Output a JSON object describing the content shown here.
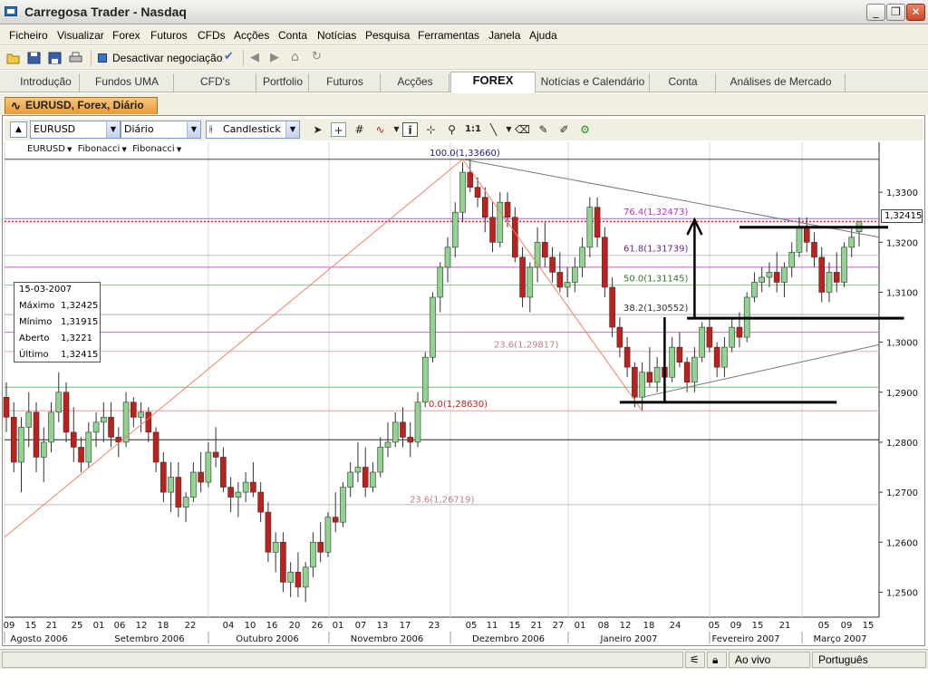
{
  "window": {
    "title": "Carregosa Trader - Nasdaq"
  },
  "menu": [
    "Ficheiro",
    "Visualizar",
    "Forex",
    "Futuros",
    "CFDs",
    "Acções",
    "Conta",
    "Notícias",
    "Pesquisa",
    "Ferramentas",
    "Janela",
    "Ajuda"
  ],
  "toolbar": {
    "deactivate_label": "Desactivar negociação"
  },
  "tabs": [
    "Introdução",
    "Fundos UMA",
    "CFD's",
    "Portfolio",
    "Futuros",
    "Acções",
    "FOREX",
    "Notícias e Calendário",
    "Conta",
    "Análises de Mercado"
  ],
  "active_tab": "FOREX",
  "document_tab": {
    "label": "EURUSD, Forex, Diário"
  },
  "chart_controls": {
    "symbol": "EURUSD",
    "period": "Diário",
    "chart_style": "Candlestick"
  },
  "chart_legend": {
    "symbol": "EURUSD",
    "study1": "Fibonacci",
    "study2": "Fibonacci"
  },
  "info_box": {
    "date": "15-03-2007",
    "max_label": "Máximo",
    "max_value": "1,32425",
    "min_label": "Mínimo",
    "min_value": "1,31915",
    "open_label": "Aberto",
    "open_value": "1,3221",
    "last_label": "Último",
    "last_value": "1,32415"
  },
  "price_marker": "1,32415",
  "status": {
    "live": "Ao vivo",
    "language": "Português"
  },
  "colors": {
    "bull": "#8fd48f",
    "bear": "#c0201c",
    "fib": "#d23ed2",
    "dotted": "#e02020"
  },
  "chart_data": {
    "type": "candlestick",
    "yaxis": {
      "min": 1.245,
      "max": 1.34,
      "ticks": [
        "1,2500",
        "1,2600",
        "1,2700",
        "1,2800",
        "1,2900",
        "1,3000",
        "1,3100",
        "1,3200",
        "1,3300"
      ]
    },
    "xticks": [
      "09",
      "15",
      "21",
      "25",
      "01",
      "06",
      "12",
      "18",
      "22",
      "04",
      "10",
      "16",
      "20",
      "26",
      "01",
      "07",
      "13",
      "17",
      "23",
      "05",
      "11",
      "15",
      "21",
      "27",
      "01",
      "08",
      "12",
      "18",
      "24",
      "05",
      "09",
      "15",
      "21",
      "05",
      "09",
      "15"
    ],
    "months": [
      "Agosto 2006",
      "Setembro 2006",
      "Outubro 2006",
      "Novembro 2006",
      "Dezembro 2006",
      "Janeiro 2007",
      "Fevereiro 2007",
      "Março 2007"
    ],
    "fib_labels": [
      {
        "text": "100.0(1,33660)",
        "y": 1.3366
      },
      {
        "text": "76.4(1,32473)",
        "y": 1.32473
      },
      {
        "text": "61.8(1,31739)",
        "y": 1.31739
      },
      {
        "text": "50.0(1,31145)",
        "y": 1.31145
      },
      {
        "text": "38.2(1,30552)",
        "y": 1.30552
      },
      {
        "text": "23.6(1,29817)",
        "y": 1.29817
      },
      {
        "text": "0.0(1,28630)",
        "y": 1.2863
      },
      {
        "text": "23.6(1,26719)",
        "y": 1.26719
      }
    ],
    "candles": [
      [
        1.289,
        1.292,
        1.282,
        1.285
      ],
      [
        1.285,
        1.288,
        1.274,
        1.276
      ],
      [
        1.276,
        1.285,
        1.27,
        1.283
      ],
      [
        1.283,
        1.29,
        1.279,
        1.286
      ],
      [
        1.286,
        1.288,
        1.274,
        1.277
      ],
      [
        1.277,
        1.283,
        1.272,
        1.28
      ],
      [
        1.28,
        1.288,
        1.278,
        1.286
      ],
      [
        1.286,
        1.294,
        1.284,
        1.29
      ],
      [
        1.29,
        1.292,
        1.28,
        1.282
      ],
      [
        1.282,
        1.287,
        1.276,
        1.279
      ],
      [
        1.279,
        1.281,
        1.274,
        1.276
      ],
      [
        1.276,
        1.284,
        1.275,
        1.282
      ],
      [
        1.282,
        1.286,
        1.279,
        1.284
      ],
      [
        1.284,
        1.288,
        1.28,
        1.285
      ],
      [
        1.285,
        1.288,
        1.279,
        1.281
      ],
      [
        1.281,
        1.283,
        1.277,
        1.28
      ],
      [
        1.28,
        1.29,
        1.279,
        1.288
      ],
      [
        1.288,
        1.289,
        1.283,
        1.285
      ],
      [
        1.285,
        1.288,
        1.282,
        1.286
      ],
      [
        1.286,
        1.287,
        1.28,
        1.282
      ],
      [
        1.282,
        1.283,
        1.274,
        1.276
      ],
      [
        1.276,
        1.278,
        1.268,
        1.27
      ],
      [
        1.27,
        1.276,
        1.266,
        1.273
      ],
      [
        1.273,
        1.276,
        1.265,
        1.267
      ],
      [
        1.267,
        1.27,
        1.264,
        1.269
      ],
      [
        1.269,
        1.276,
        1.268,
        1.274
      ],
      [
        1.274,
        1.278,
        1.27,
        1.272
      ],
      [
        1.272,
        1.28,
        1.271,
        1.278
      ],
      [
        1.278,
        1.283,
        1.275,
        1.277
      ],
      [
        1.277,
        1.279,
        1.27,
        1.271
      ],
      [
        1.271,
        1.273,
        1.266,
        1.269
      ],
      [
        1.269,
        1.272,
        1.265,
        1.27
      ],
      [
        1.27,
        1.274,
        1.268,
        1.272
      ],
      [
        1.272,
        1.276,
        1.269,
        1.27
      ],
      [
        1.27,
        1.272,
        1.264,
        1.266
      ],
      [
        1.266,
        1.268,
        1.256,
        1.258
      ],
      [
        1.258,
        1.262,
        1.254,
        1.26
      ],
      [
        1.26,
        1.262,
        1.25,
        1.252
      ],
      [
        1.252,
        1.256,
        1.249,
        1.254
      ],
      [
        1.254,
        1.258,
        1.249,
        1.251
      ],
      [
        1.251,
        1.256,
        1.248,
        1.255
      ],
      [
        1.255,
        1.262,
        1.253,
        1.26
      ],
      [
        1.26,
        1.264,
        1.256,
        1.258
      ],
      [
        1.258,
        1.266,
        1.257,
        1.265
      ],
      [
        1.265,
        1.27,
        1.262,
        1.264
      ],
      [
        1.264,
        1.272,
        1.263,
        1.271
      ],
      [
        1.271,
        1.276,
        1.269,
        1.274
      ],
      [
        1.274,
        1.28,
        1.272,
        1.275
      ],
      [
        1.275,
        1.279,
        1.269,
        1.271
      ],
      [
        1.271,
        1.276,
        1.27,
        1.274
      ],
      [
        1.274,
        1.281,
        1.273,
        1.279
      ],
      [
        1.279,
        1.284,
        1.277,
        1.28
      ],
      [
        1.28,
        1.286,
        1.279,
        1.284
      ],
      [
        1.284,
        1.287,
        1.279,
        1.281
      ],
      [
        1.281,
        1.284,
        1.277,
        1.28
      ],
      [
        1.28,
        1.29,
        1.279,
        1.288
      ],
      [
        1.288,
        1.298,
        1.287,
        1.297
      ],
      [
        1.297,
        1.31,
        1.296,
        1.309
      ],
      [
        1.309,
        1.316,
        1.306,
        1.315
      ],
      [
        1.315,
        1.321,
        1.312,
        1.319
      ],
      [
        1.319,
        1.328,
        1.317,
        1.326
      ],
      [
        1.326,
        1.336,
        1.324,
        1.334
      ],
      [
        1.334,
        1.3366,
        1.33,
        1.331
      ],
      [
        1.331,
        1.333,
        1.327,
        1.329
      ],
      [
        1.329,
        1.331,
        1.322,
        1.325
      ],
      [
        1.325,
        1.328,
        1.318,
        1.32
      ],
      [
        1.32,
        1.33,
        1.319,
        1.328
      ],
      [
        1.328,
        1.33,
        1.323,
        1.325
      ],
      [
        1.325,
        1.327,
        1.316,
        1.317
      ],
      [
        1.317,
        1.319,
        1.307,
        1.309
      ],
      [
        1.309,
        1.316,
        1.306,
        1.315
      ],
      [
        1.315,
        1.323,
        1.312,
        1.32
      ],
      [
        1.32,
        1.324,
        1.315,
        1.317
      ],
      [
        1.317,
        1.319,
        1.312,
        1.314
      ],
      [
        1.314,
        1.318,
        1.31,
        1.311
      ],
      [
        1.311,
        1.315,
        1.309,
        1.312
      ],
      [
        1.312,
        1.317,
        1.31,
        1.315
      ],
      [
        1.315,
        1.321,
        1.313,
        1.319
      ],
      [
        1.319,
        1.329,
        1.317,
        1.327
      ],
      [
        1.327,
        1.329,
        1.319,
        1.321
      ],
      [
        1.321,
        1.323,
        1.309,
        1.311
      ],
      [
        1.311,
        1.313,
        1.301,
        1.303
      ],
      [
        1.303,
        1.305,
        1.297,
        1.299
      ],
      [
        1.299,
        1.301,
        1.293,
        1.295
      ],
      [
        1.295,
        1.296,
        1.287,
        1.289
      ],
      [
        1.289,
        1.296,
        1.2863,
        1.294
      ],
      [
        1.294,
        1.299,
        1.291,
        1.292
      ],
      [
        1.292,
        1.297,
        1.29,
        1.295
      ],
      [
        1.295,
        1.297,
        1.292,
        1.293
      ],
      [
        1.293,
        1.301,
        1.292,
        1.299
      ],
      [
        1.299,
        1.302,
        1.295,
        1.296
      ],
      [
        1.296,
        1.297,
        1.29,
        1.292
      ],
      [
        1.292,
        1.299,
        1.29,
        1.297
      ],
      [
        1.297,
        1.304,
        1.296,
        1.303
      ],
      [
        1.303,
        1.305,
        1.298,
        1.299
      ],
      [
        1.299,
        1.3,
        1.293,
        1.295
      ],
      [
        1.295,
        1.301,
        1.293,
        1.299
      ],
      [
        1.299,
        1.305,
        1.298,
        1.303
      ],
      [
        1.303,
        1.306,
        1.299,
        1.301
      ],
      [
        1.301,
        1.31,
        1.3,
        1.309
      ],
      [
        1.309,
        1.314,
        1.308,
        1.312
      ],
      [
        1.312,
        1.315,
        1.31,
        1.313
      ],
      [
        1.313,
        1.316,
        1.311,
        1.314
      ],
      [
        1.314,
        1.318,
        1.31,
        1.312
      ],
      [
        1.312,
        1.316,
        1.309,
        1.315
      ],
      [
        1.315,
        1.32,
        1.313,
        1.318
      ],
      [
        1.318,
        1.325,
        1.317,
        1.323
      ],
      [
        1.323,
        1.325,
        1.318,
        1.32
      ],
      [
        1.32,
        1.322,
        1.315,
        1.317
      ],
      [
        1.317,
        1.319,
        1.308,
        1.31
      ],
      [
        1.31,
        1.316,
        1.308,
        1.314
      ],
      [
        1.314,
        1.318,
        1.31,
        1.312
      ],
      [
        1.312,
        1.32,
        1.311,
        1.319
      ],
      [
        1.319,
        1.323,
        1.317,
        1.321
      ],
      [
        1.3221,
        1.32425,
        1.31915,
        1.32415
      ]
    ]
  }
}
